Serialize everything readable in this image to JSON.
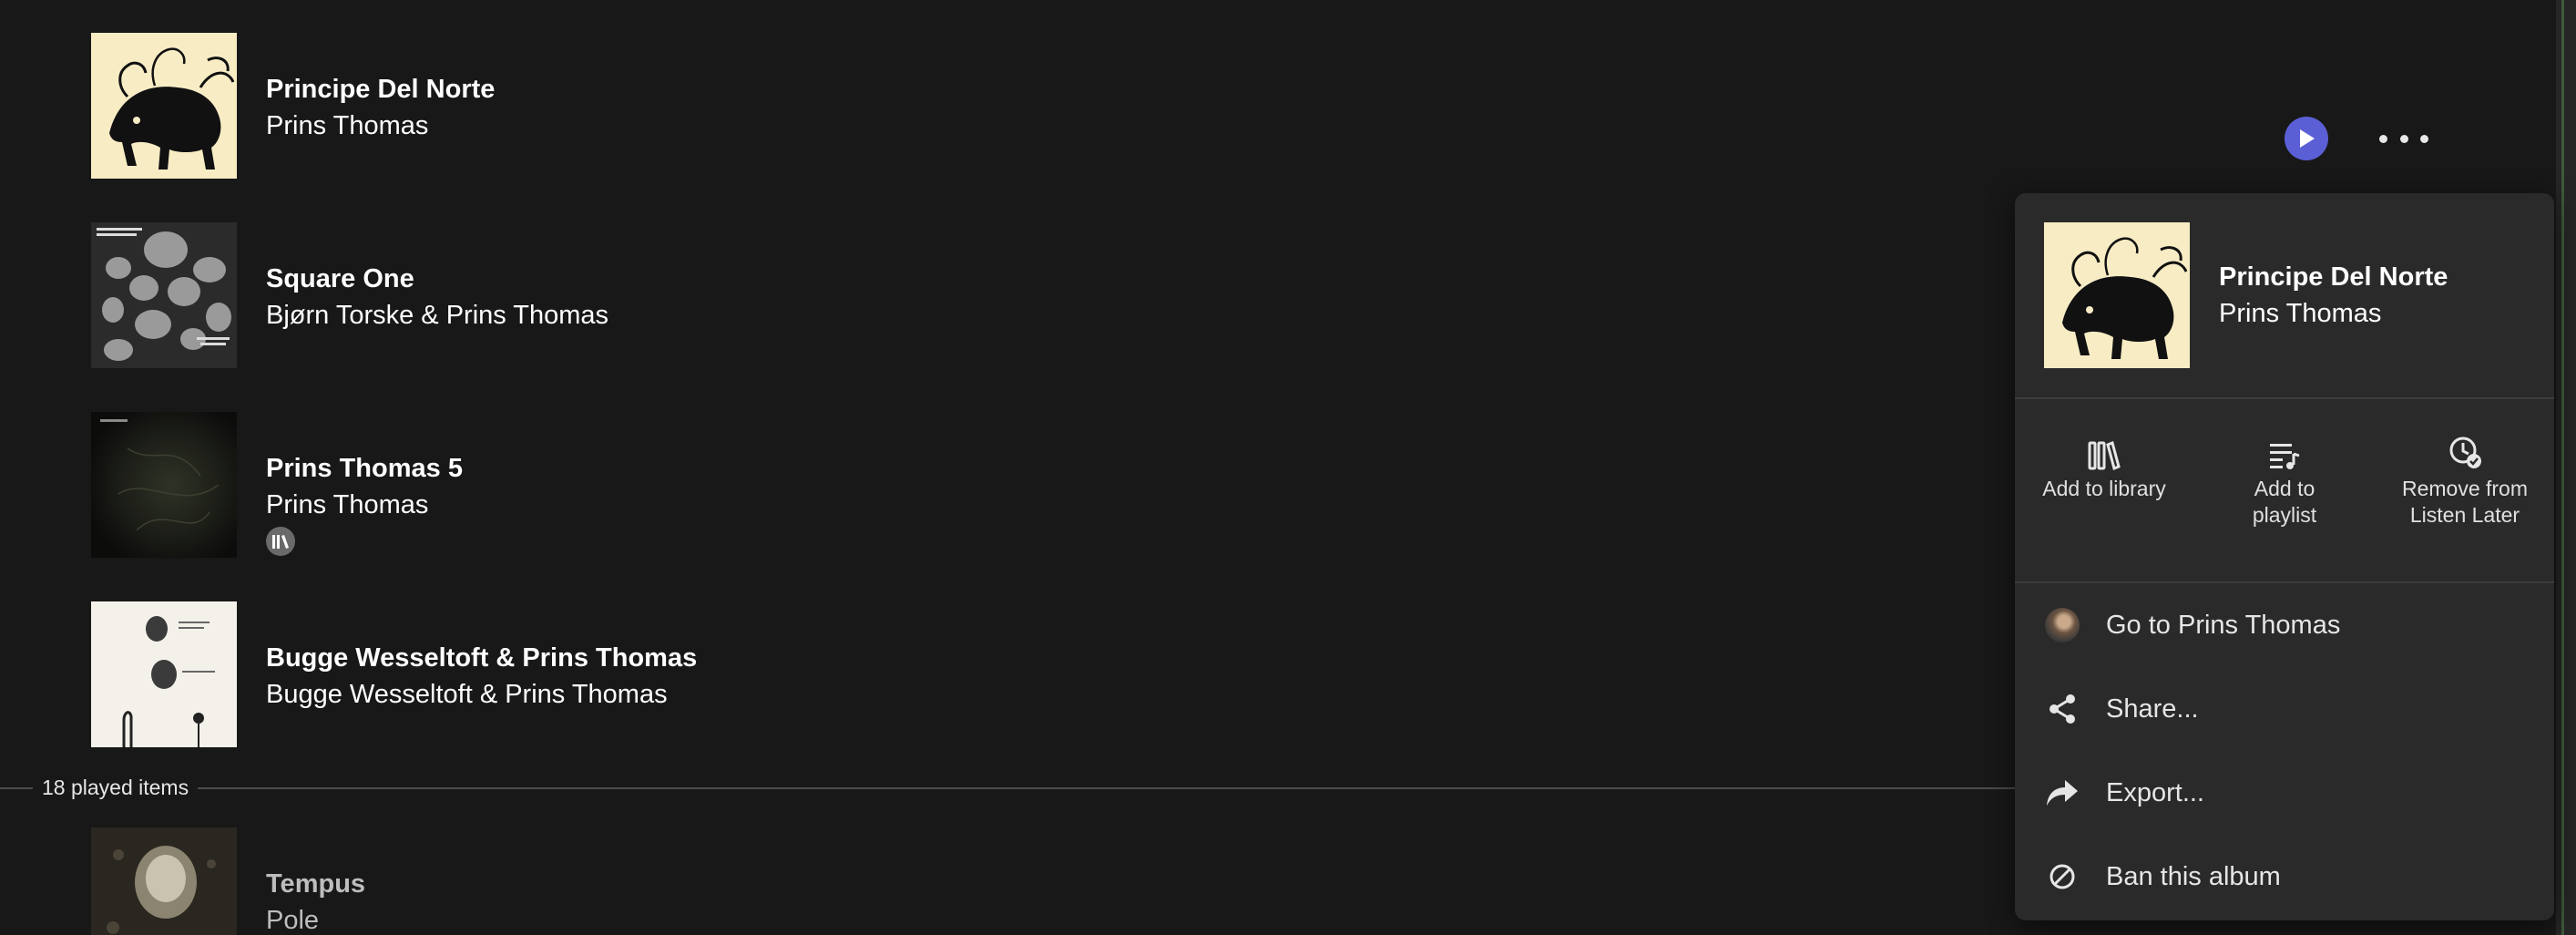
{
  "albums": [
    {
      "title": "Principe Del Norte",
      "artist": "Prins Thomas",
      "art": "principe-cover"
    },
    {
      "title": "Square One",
      "artist": "Bjørn Torske & Prins Thomas",
      "art": "square-one-cover"
    },
    {
      "title": "Prins Thomas 5",
      "artist": "Prins Thomas",
      "art": "prins-thomas-5-cover",
      "in_library": true
    },
    {
      "title": "Bugge Wesseltoft & Prins Thomas",
      "artist": "Bugge Wesseltoft & Prins Thomas",
      "art": "bugge-cover"
    },
    {
      "title": "Tempus",
      "artist": "Pole",
      "art": "tempus-cover"
    }
  ],
  "played_divider": {
    "label": "18 played items"
  },
  "row_controls": {
    "play_icon": "play-icon",
    "more_icon": "more-horizontal-icon",
    "accent": "#5b5fd6"
  },
  "menu": {
    "title": "Principe Del Norte",
    "artist": "Prins Thomas",
    "actions": [
      {
        "label": "Add to library",
        "icon": "library-icon"
      },
      {
        "label": "Add to\nplaylist",
        "icon": "playlist-add-icon"
      },
      {
        "label": "Remove from\nListen Later",
        "icon": "clock-check-icon"
      }
    ],
    "items": [
      {
        "label": "Go to Prins Thomas",
        "icon": "artist-avatar"
      },
      {
        "label": "Share...",
        "icon": "share-icon"
      },
      {
        "label": "Export...",
        "icon": "export-arrow-icon"
      },
      {
        "label": "Ban this album",
        "icon": "ban-icon"
      }
    ]
  },
  "colors": {
    "background": "#181818",
    "menu_background": "#2a2a2a",
    "accent": "#5b5fd6"
  }
}
